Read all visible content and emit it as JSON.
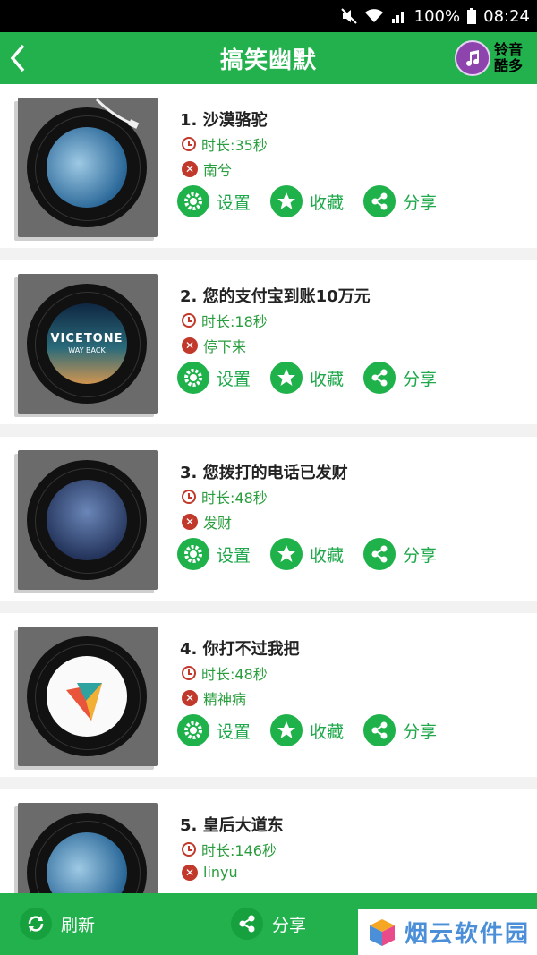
{
  "status": {
    "battery": "100%",
    "time": "08:24"
  },
  "header": {
    "title": "搞笑幽默",
    "brand": "铃音酷多"
  },
  "songs": [
    {
      "title": "1. 沙漠骆驼",
      "duration": "时长:35秒",
      "singer": "南兮"
    },
    {
      "title": "2. 您的支付宝到账10万元",
      "duration": "时长:18秒",
      "singer": "停下来"
    },
    {
      "title": "3. 您拨打的电话已发财",
      "duration": "时长:48秒",
      "singer": "发财"
    },
    {
      "title": "4. 你打不过我把",
      "duration": "时长:48秒",
      "singer": "精神病"
    },
    {
      "title": "5. 皇后大道东",
      "duration": "时长:146秒",
      "singer": "linyu"
    }
  ],
  "actions": {
    "settings": "设置",
    "favorite": "收藏",
    "share": "分享"
  },
  "album_text": {
    "vicetone": "VICETONE",
    "wayback": "WAY BACK"
  },
  "bottom": {
    "refresh": "刷新",
    "share": "分享"
  },
  "watermark": "烟云软件园",
  "colors": {
    "green": "#22b14c",
    "accent": "#1fb24a",
    "red": "#c0392b"
  }
}
